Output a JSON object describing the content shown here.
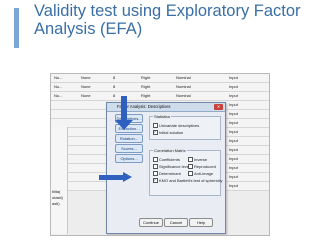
{
  "slide": {
    "title": "Validity test using Exploratory Factor Analysis (EFA)"
  },
  "grid_rows": [
    {
      "cells": [
        "Nu...",
        "None",
        "8",
        "Right",
        "Nominal",
        "Input"
      ]
    },
    {
      "cells": [
        "Nu...",
        "None",
        "8",
        "Right",
        "Nominal",
        "Input"
      ]
    },
    {
      "cells": [
        "Nu...",
        "None",
        "8",
        "Right",
        "Nominal",
        "Input"
      ]
    },
    {
      "cells": [
        "",
        "",
        "",
        "",
        "",
        "Input"
      ]
    },
    {
      "cells": [
        "",
        "",
        "",
        "",
        "",
        "Input"
      ]
    },
    {
      "cells": [
        "",
        "",
        "",
        "",
        "",
        "Input"
      ]
    },
    {
      "cells": [
        "",
        "",
        "",
        "",
        "",
        "Input"
      ]
    },
    {
      "cells": [
        "",
        "",
        "",
        "",
        "",
        "Input"
      ]
    },
    {
      "cells": [
        "",
        "",
        "",
        "",
        "",
        "Input"
      ]
    },
    {
      "cells": [
        "",
        "",
        "",
        "",
        "",
        "Input"
      ]
    },
    {
      "cells": [
        "",
        "",
        "",
        "",
        "",
        "Input"
      ]
    },
    {
      "cells": [
        "",
        "",
        "",
        "",
        "",
        "Input"
      ]
    },
    {
      "cells": [
        "",
        "",
        "",
        "",
        "",
        "Input"
      ]
    }
  ],
  "left_panel": [
    "tilita(",
    "otasti)",
    "asti)"
  ],
  "dialog": {
    "title": "Factor Analysis: Descriptives",
    "close_label": "✕",
    "side_buttons": [
      "Descriptives...",
      "Extraction...",
      "Rotation...",
      "Scores...",
      "Options..."
    ],
    "statistics_label": "Statistics",
    "statistics": [
      {
        "label": "Univariate descriptives",
        "checked": false
      },
      {
        "label": "Initial solution",
        "checked": true
      }
    ],
    "correlation_label": "Correlation Matrix",
    "correlation": [
      {
        "label": "Coefficients",
        "checked": false
      },
      {
        "label": "Inverse",
        "checked": false
      },
      {
        "label": "Significance levels",
        "checked": false
      },
      {
        "label": "Reproduced",
        "checked": false
      },
      {
        "label": "Determinant",
        "checked": false
      },
      {
        "label": "Anti-image",
        "checked": false
      },
      {
        "label": "KMO and Bartlett's test of sphericity",
        "checked": true
      }
    ],
    "buttons": {
      "continue": "Continue",
      "cancel": "Cancel",
      "help": "Help"
    }
  },
  "colors": {
    "title": "#3a6fa5",
    "arrow": "#2f5fbf"
  }
}
